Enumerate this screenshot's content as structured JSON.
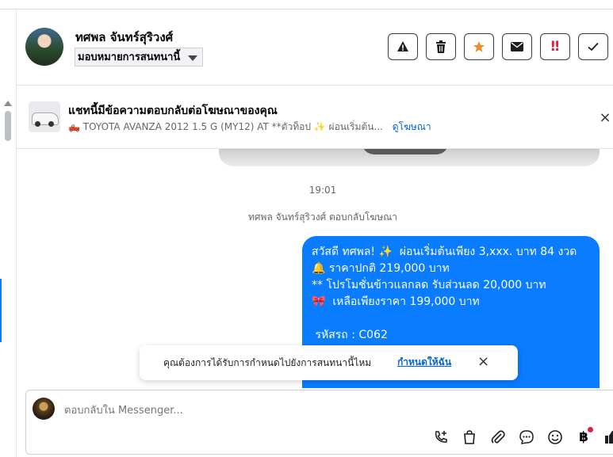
{
  "header": {
    "contact_name": "ทศพล จันทร์สุริวงศ์",
    "assign_label": "มอบหมายการสนทนานี้",
    "actions": [
      {
        "name": "report-button",
        "icon": "warning-icon",
        "glyph": "⚠",
        "color": "#1c1e21"
      },
      {
        "name": "delete-button",
        "icon": "trash-icon",
        "glyph": "🗑",
        "color": "#1c1e21"
      },
      {
        "name": "star-button",
        "icon": "star-icon",
        "glyph": "★",
        "color": "#f28c28"
      },
      {
        "name": "mark-unread-button",
        "icon": "envelope-icon",
        "glyph": "✉",
        "color": "#1c1e21"
      },
      {
        "name": "important-button",
        "icon": "double-exclamation-icon",
        "glyph": "‼",
        "color": "#e41e3f"
      },
      {
        "name": "done-button",
        "icon": "check-icon",
        "glyph": "✓",
        "color": "#1c1e21"
      }
    ]
  },
  "ad_banner": {
    "title": "แชทนี้มีข้อความตอบกลับต่อโฆษณาของคุณ",
    "car_emoji": "🛻",
    "subtitle": "TOYOTA AVANZA 2012 1.5 G (MY12) AT **ตัวท็อป",
    "sparkle": "✨",
    "subtitle_tail": "ผ่อนเริ่มต้น...",
    "link": "ดูโฆษณา",
    "close": "×"
  },
  "chat": {
    "timestamp": "19:01",
    "replied_note": "ทศพล จันทร์สุริวงศ์ ตอบกลับโฆษณา",
    "message": {
      "line1_a": "สวัสดี ทศพล! ",
      "line1_spark": "✨",
      "line1_b": "  ผ่อนเริ่มต้นเพียง 3,xxx. บาท 84 งวด",
      "line2_icon": "🔔",
      "line2": " ราคาปกติ 219,000 บาท",
      "line3": "** โปรโมชั่นข้าวแลกลด รับส่วนลด 20,000 บาท",
      "line4_icon": "🎀",
      "line4": "  เหลือเพียงราคา 199,000 บาท",
      "line5": "",
      "line6": " รหัสรถ : C062"
    }
  },
  "notice": {
    "text": "คุณต้องการได้รับการกำหนดไปยังการสนทนานี้ไหม",
    "link": "กำหนดให้ฉัน",
    "close": "×"
  },
  "composer": {
    "placeholder": "ตอบกลับใน Messenger...",
    "tools": [
      "add-call-icon",
      "shopping-bag-icon",
      "attach-icon",
      "saved-reply-icon",
      "emoji-icon",
      "payment-baht-icon",
      "like-icon"
    ],
    "baht_symbol": "฿"
  }
}
